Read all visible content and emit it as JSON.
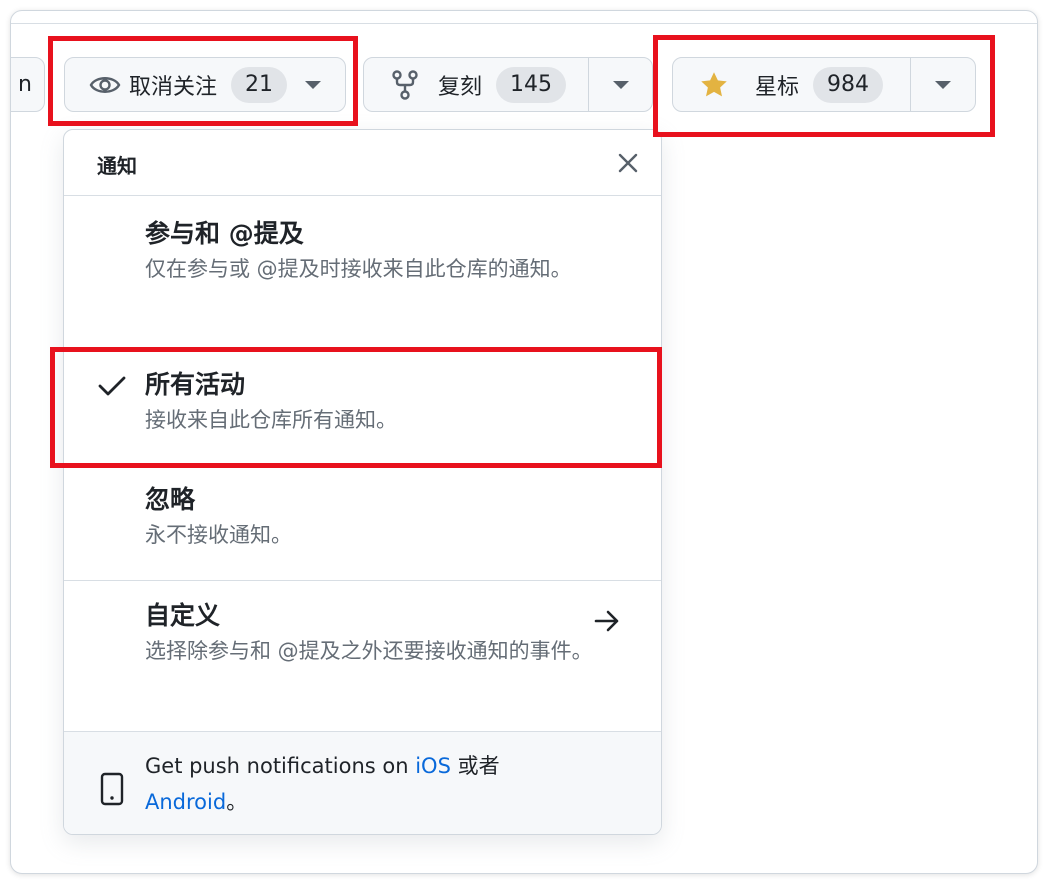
{
  "toolbar": {
    "partial_label": "n",
    "watch": {
      "label": "取消关注",
      "count": "21",
      "icon": "eye-icon"
    },
    "fork": {
      "label": "复刻",
      "count": "145",
      "icon": "repo-forked-icon"
    },
    "star": {
      "label": "星标",
      "count": "984",
      "icon": "star-icon",
      "icon_color": "#e3b341"
    }
  },
  "menu": {
    "title": "通知",
    "close_icon": "x-icon",
    "options": [
      {
        "title": "参与和 @提及",
        "desc": "仅在参与或 @提及时接收来自此仓库的通知。",
        "selected": false
      },
      {
        "title": "所有活动",
        "desc": "接收来自此仓库所有通知。",
        "selected": true
      },
      {
        "title": "忽略",
        "desc": "永不接收通知。",
        "selected": false
      },
      {
        "title": "自定义",
        "desc": "选择除参与和 @提及之外还要接收通知的事件。",
        "selected": false
      }
    ],
    "footer": {
      "text_prefix": "Get push notifications on ",
      "ios": "iOS",
      "or": " 或者",
      "android": "Android",
      "period": "。"
    }
  },
  "colors": {
    "highlight": "#e8111d",
    "link": "#0969da",
    "muted_text": "#656d76"
  }
}
